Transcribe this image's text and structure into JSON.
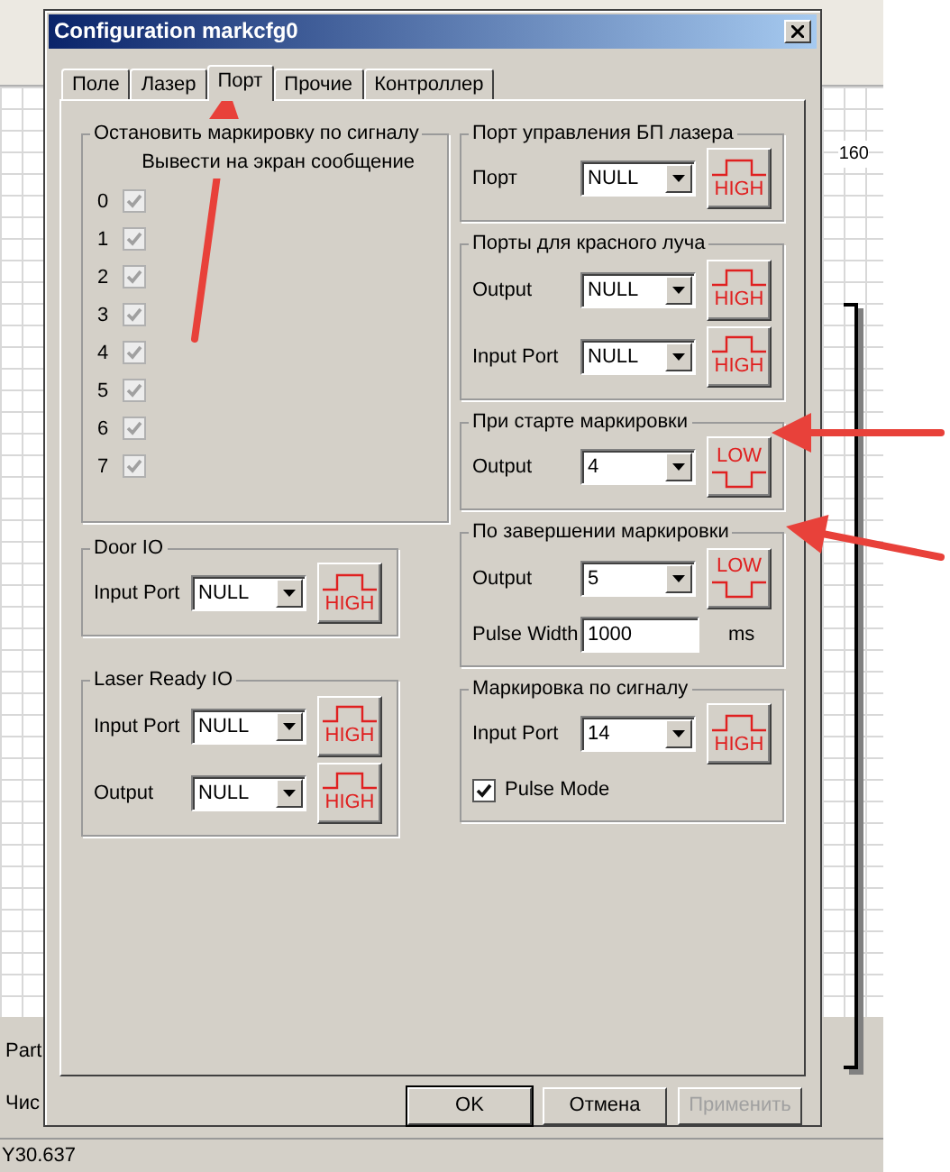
{
  "window": {
    "title": "Configuration markcfg0"
  },
  "tabs": [
    {
      "label": "Поле",
      "selected": false
    },
    {
      "label": "Лазер",
      "selected": false
    },
    {
      "label": "Порт",
      "selected": true
    },
    {
      "label": "Прочие",
      "selected": false
    },
    {
      "label": "Контроллер",
      "selected": false
    }
  ],
  "stop_group": {
    "title": "Остановить маркировку по сигналу",
    "message_label": "Вывести на экран сообщение",
    "signals": [
      {
        "label": "0",
        "checked": true,
        "disabled": true
      },
      {
        "label": "1",
        "checked": true,
        "disabled": true
      },
      {
        "label": "2",
        "checked": true,
        "disabled": true
      },
      {
        "label": "3",
        "checked": true,
        "disabled": true
      },
      {
        "label": "4",
        "checked": true,
        "disabled": true
      },
      {
        "label": "5",
        "checked": true,
        "disabled": true
      },
      {
        "label": "6",
        "checked": true,
        "disabled": true
      },
      {
        "label": "7",
        "checked": true,
        "disabled": true
      }
    ]
  },
  "left_groups": [
    {
      "title": "Door IO",
      "rows": [
        {
          "kind": "select",
          "label": "Input Port",
          "value": "NULL",
          "signal": {
            "kind": "high",
            "text": "HIGH"
          }
        }
      ]
    },
    {
      "title": "Laser Ready IO",
      "rows": [
        {
          "kind": "select",
          "label": "Input Port",
          "value": "NULL",
          "signal": {
            "kind": "high",
            "text": "HIGH"
          }
        },
        {
          "kind": "select",
          "label": "Output",
          "value": "NULL",
          "signal": {
            "kind": "high",
            "text": "HIGH"
          }
        }
      ]
    }
  ],
  "right_groups": [
    {
      "title": "Порт управления БП лазера",
      "rows": [
        {
          "kind": "select",
          "label": "Порт",
          "value": "NULL",
          "signal": {
            "kind": "high",
            "text": "HIGH"
          }
        }
      ]
    },
    {
      "title": "Порты для красного луча",
      "rows": [
        {
          "kind": "select",
          "label": "Output",
          "value": "NULL",
          "signal": {
            "kind": "high",
            "text": "HIGH"
          }
        },
        {
          "kind": "select",
          "label": "Input Port",
          "value": "NULL",
          "signal": {
            "kind": "high",
            "text": "HIGH"
          }
        }
      ]
    },
    {
      "title": "При старте маркировки",
      "rows": [
        {
          "kind": "select",
          "label": "Output",
          "value": "4",
          "signal": {
            "kind": "low",
            "text": "LOW"
          }
        }
      ]
    },
    {
      "title": "По завершении маркировки",
      "rows": [
        {
          "kind": "select",
          "label": "Output",
          "value": "5",
          "signal": {
            "kind": "low",
            "text": "LOW"
          }
        },
        {
          "kind": "input",
          "label": "Pulse Width",
          "value": "1000",
          "unit": "ms"
        }
      ]
    },
    {
      "title": "Маркировка по сигналу",
      "rows": [
        {
          "kind": "select",
          "label": "Input Port",
          "value": "14",
          "signal": {
            "kind": "high",
            "text": "HIGH"
          }
        },
        {
          "kind": "checkbox",
          "label": "Pulse Mode",
          "checked": true
        }
      ]
    }
  ],
  "buttons": [
    {
      "label": "OK",
      "default": true,
      "disabled": false
    },
    {
      "label": "Отмена",
      "default": false,
      "disabled": false
    },
    {
      "label": "Применить",
      "default": false,
      "disabled": true
    }
  ],
  "background": {
    "ruler_label": "160",
    "labels": [
      "Part",
      "Чис"
    ],
    "status": "Y30.637"
  }
}
